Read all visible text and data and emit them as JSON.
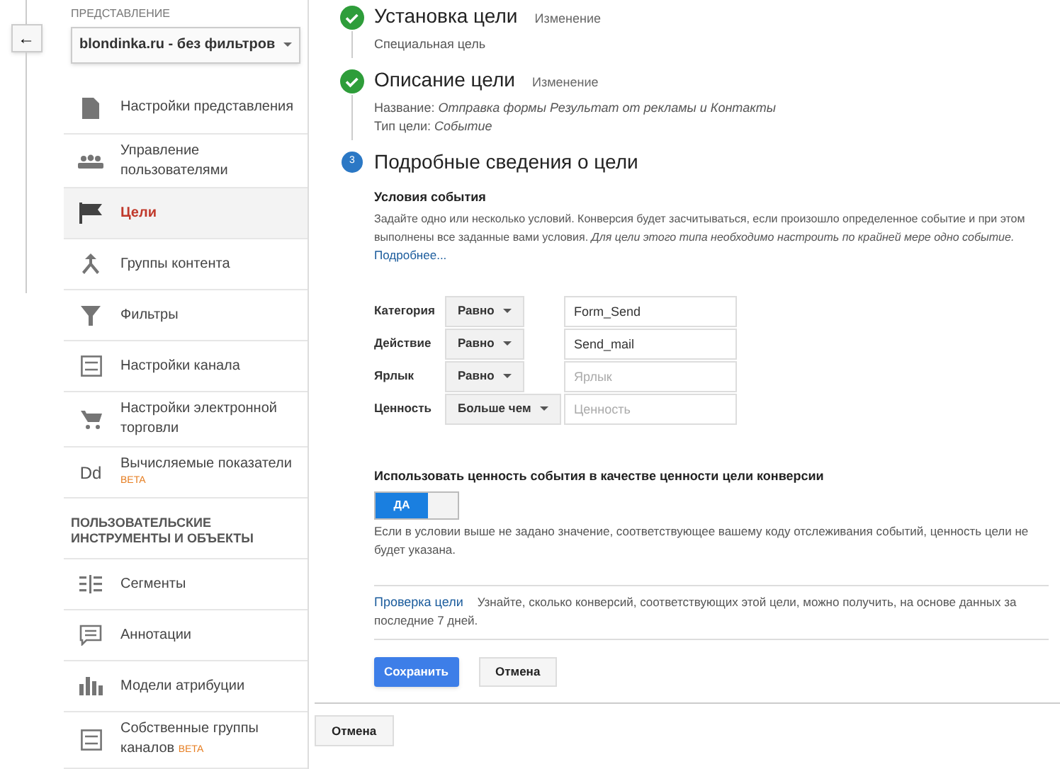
{
  "sidebar": {
    "back_button": {
      "label": "←"
    },
    "view_label": "ПРЕДСТАВЛЕНИЕ",
    "view_select": {
      "value": "blondinka.ru - без фильтров"
    },
    "items": [
      {
        "kind": "doc",
        "label": "Настройки представления",
        "selected": false
      },
      {
        "kind": "people",
        "label": "Управление пользователями",
        "selected": false
      },
      {
        "kind": "flag",
        "label": "Цели",
        "selected": true
      },
      {
        "kind": "groups",
        "label": "Группы контента",
        "selected": false
      },
      {
        "kind": "filter",
        "label": "Фильтры",
        "selected": false
      },
      {
        "kind": "channel",
        "label": "Настройки канала",
        "selected": false
      },
      {
        "kind": "cart",
        "label": "Настройки электронной торговли",
        "selected": false
      },
      {
        "kind": "text",
        "icon_text": "Dd",
        "label": "Вычисляемые показатели",
        "badge": "BETA",
        "selected": false
      }
    ],
    "section_title": "ПОЛЬЗОВАТЕЛЬСКИЕ ИНСТРУМЕНТЫ И ОБЪЕКТЫ",
    "tools": [
      {
        "kind": "segments",
        "label": "Сегменты",
        "selected": false
      },
      {
        "kind": "comment",
        "label": "Аннотации",
        "selected": false
      },
      {
        "kind": "bars",
        "label": "Модели атрибуции",
        "selected": false
      },
      {
        "kind": "channel",
        "label": "Собственные группы каналов",
        "badge": "BETA",
        "selected": false
      }
    ]
  },
  "steps": [
    {
      "completed": true,
      "title": "Установка цели",
      "edit_link": "Изменение",
      "details": [
        "Специальная цель"
      ]
    },
    {
      "completed": true,
      "title": "Описание цели",
      "edit_link": "Изменение",
      "details": [
        "Название: *Отправка формы Результат от рекламы и Контакты*",
        "Тип цели: *Событие*"
      ]
    },
    {
      "completed": false,
      "marker": "3",
      "title": "Подробные сведения о цели"
    }
  ],
  "conditions": {
    "heading": "Условия события",
    "description": "Задайте одно или несколько условий. Конверсия будет засчитываться, если произошло определенное событие и при этом выполнены все заданные вами условия. *Для цели этого типа необходимо настроить по крайней мере одно событие.*",
    "more_link": "Подробнее...",
    "rows": [
      {
        "label": "Категория",
        "operator": "Равно",
        "value": "Form_Send"
      },
      {
        "label": "Действие",
        "operator": "Равно",
        "value": "Send_mail"
      },
      {
        "label": "Ярлык",
        "operator": "Равно",
        "placeholder": "Ярлык"
      },
      {
        "label": "Ценность",
        "operator": "Больше чем",
        "placeholder": "Ценность"
      }
    ]
  },
  "use_value": {
    "label": "Использовать ценность события в качестве ценности цели конверсии",
    "toggle": {
      "on": true,
      "label": "ДА"
    },
    "note": "Если в условии выше не задано значение, соответствующее вашему коду отслеживания событий, ценность цели не будет указана."
  },
  "verify": {
    "link": "Проверка цели",
    "text": "Узнайте, сколько конверсий, соответствующих этой цели, можно получить, на основе данных за последние 7 дней."
  },
  "buttons": {
    "save": "Сохранить",
    "cancel": "Отмена"
  },
  "footer_cancel": "Отмена"
}
